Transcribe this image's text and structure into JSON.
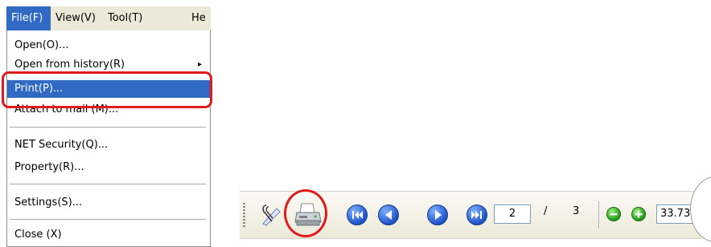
{
  "menubar": {
    "items": [
      {
        "label": "File(F)"
      },
      {
        "label": "View(V)"
      },
      {
        "label": "Tool(T)"
      },
      {
        "label": "He"
      }
    ]
  },
  "file_menu": {
    "items": [
      {
        "label": "Open(O)..."
      },
      {
        "label": "Open from history(R)",
        "submenu_arrow": "▸"
      },
      {
        "label": "Print(P)..."
      },
      {
        "label": "Attach to mail (M)..."
      },
      {
        "label": "NET Security(Q)..."
      },
      {
        "label": "Property(R)..."
      },
      {
        "label": "Settings(S)..."
      },
      {
        "label": "Close (X)"
      }
    ]
  },
  "toolbar": {
    "icons": [
      "attach-icon",
      "print-icon",
      "first-page-icon",
      "previous-page-icon",
      "next-page-icon",
      "last-page-icon",
      "zoom-out-icon",
      "zoom-in-icon"
    ],
    "page_current": "2",
    "page_separator": "/",
    "page_total": "3",
    "zoom_value": "33.73"
  },
  "colors": {
    "menu_selected": "#316ac5",
    "highlight": "#e01b1b",
    "nav_button": "#1f52c8",
    "zoom_button": "#1f9a18"
  }
}
